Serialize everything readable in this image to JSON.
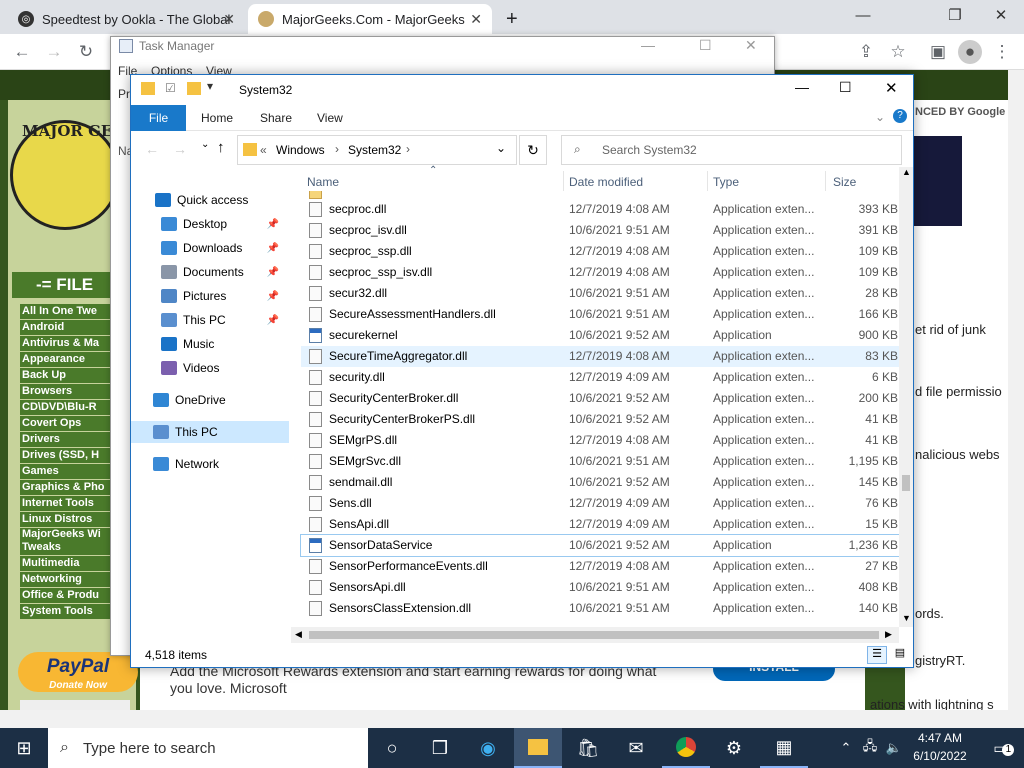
{
  "chrome": {
    "tabs": [
      {
        "title": "Speedtest by Ookla - The Global",
        "close": "✕"
      },
      {
        "title": "MajorGeeks.Com - MajorGeeks",
        "close": "✕"
      }
    ],
    "new_tab": "+"
  },
  "webpage": {
    "logo_text": "MAJOR GE",
    "files_header": "-= FILE",
    "categories": [
      "All In One Twe",
      "Android",
      "Antivirus & Ma",
      "Appearance",
      "Back Up",
      "Browsers",
      "CD\\DVD\\Blu-R",
      "Covert Ops",
      "Drivers",
      "Drives (SSD, H",
      "Games",
      "Graphics & Pho",
      "Internet Tools",
      "Linux Distros",
      "MajorGeeks Wi Tweaks",
      "Multimedia",
      "Networking",
      "Office & Produ",
      "System Tools"
    ],
    "paypal": "PayPal",
    "paypal_sub": "Donate Now",
    "google_text": "NCED BY Google",
    "right_snippets": [
      "et rid of junk",
      "d file permissio",
      "nalicious webs",
      "ords.",
      "gistryRT.",
      "ations with lightning s"
    ],
    "ad_text": "Add the Microsoft Rewards extension and start earning rewards for doing what you love. Microsoft",
    "ad_button": "INSTALL"
  },
  "task_manager": {
    "title": "Task Manager",
    "menu": [
      "File",
      "Options",
      "View"
    ],
    "tab_frag": "Pr",
    "col_frag": "Na"
  },
  "explorer": {
    "title": "System32",
    "ribbon_tabs": [
      "File",
      "Home",
      "Share",
      "View"
    ],
    "breadcrumb": [
      "«",
      "Windows",
      "›",
      "System32",
      "›"
    ],
    "search_placeholder": "Search System32",
    "nav": [
      {
        "label": "Quick access"
      },
      {
        "label": "Desktop",
        "pin": "📌"
      },
      {
        "label": "Downloads",
        "pin": "📌"
      },
      {
        "label": "Documents",
        "pin": "📌"
      },
      {
        "label": "Pictures",
        "pin": "📌"
      },
      {
        "label": "This PC",
        "pin": "📌"
      },
      {
        "label": "Music"
      },
      {
        "label": "Videos"
      },
      {
        "label": "OneDrive"
      },
      {
        "label": "This PC"
      },
      {
        "label": "Network"
      }
    ],
    "columns": [
      "Name",
      "Date modified",
      "Type",
      "Size"
    ],
    "files": [
      {
        "name": "secproc.dll",
        "date": "12/7/2019 4:08 AM",
        "type": "Application exten...",
        "size": "393 KB"
      },
      {
        "name": "secproc_isv.dll",
        "date": "10/6/2021 9:51 AM",
        "type": "Application exten...",
        "size": "391 KB"
      },
      {
        "name": "secproc_ssp.dll",
        "date": "12/7/2019 4:08 AM",
        "type": "Application exten...",
        "size": "109 KB"
      },
      {
        "name": "secproc_ssp_isv.dll",
        "date": "12/7/2019 4:08 AM",
        "type": "Application exten...",
        "size": "109 KB"
      },
      {
        "name": "secur32.dll",
        "date": "10/6/2021 9:51 AM",
        "type": "Application exten...",
        "size": "28 KB"
      },
      {
        "name": "SecureAssessmentHandlers.dll",
        "date": "10/6/2021 9:51 AM",
        "type": "Application exten...",
        "size": "166 KB"
      },
      {
        "name": "securekernel",
        "date": "10/6/2021 9:52 AM",
        "type": "Application",
        "size": "900 KB"
      },
      {
        "name": "SecureTimeAggregator.dll",
        "date": "12/7/2019 4:08 AM",
        "type": "Application exten...",
        "size": "83 KB"
      },
      {
        "name": "security.dll",
        "date": "12/7/2019 4:09 AM",
        "type": "Application exten...",
        "size": "6 KB"
      },
      {
        "name": "SecurityCenterBroker.dll",
        "date": "10/6/2021 9:52 AM",
        "type": "Application exten...",
        "size": "200 KB"
      },
      {
        "name": "SecurityCenterBrokerPS.dll",
        "date": "10/6/2021 9:52 AM",
        "type": "Application exten...",
        "size": "41 KB"
      },
      {
        "name": "SEMgrPS.dll",
        "date": "12/7/2019 4:08 AM",
        "type": "Application exten...",
        "size": "41 KB"
      },
      {
        "name": "SEMgrSvc.dll",
        "date": "10/6/2021 9:51 AM",
        "type": "Application exten...",
        "size": "1,195 KB"
      },
      {
        "name": "sendmail.dll",
        "date": "10/6/2021 9:52 AM",
        "type": "Application exten...",
        "size": "145 KB"
      },
      {
        "name": "Sens.dll",
        "date": "12/7/2019 4:09 AM",
        "type": "Application exten...",
        "size": "76 KB"
      },
      {
        "name": "SensApi.dll",
        "date": "12/7/2019 4:09 AM",
        "type": "Application exten...",
        "size": "15 KB"
      },
      {
        "name": "SensorDataService",
        "date": "10/6/2021 9:52 AM",
        "type": "Application",
        "size": "1,236 KB"
      },
      {
        "name": "SensorPerformanceEvents.dll",
        "date": "12/7/2019 4:08 AM",
        "type": "Application exten...",
        "size": "27 KB"
      },
      {
        "name": "SensorsApi.dll",
        "date": "10/6/2021 9:51 AM",
        "type": "Application exten...",
        "size": "408 KB"
      },
      {
        "name": "SensorsClassExtension.dll",
        "date": "10/6/2021 9:51 AM",
        "type": "Application exten...",
        "size": "140 KB"
      }
    ],
    "item_count": "4,518 items"
  },
  "taskbar": {
    "search_placeholder": "Type here to search",
    "time": "4:47 AM",
    "date": "6/10/2022",
    "notif_count": "1"
  }
}
